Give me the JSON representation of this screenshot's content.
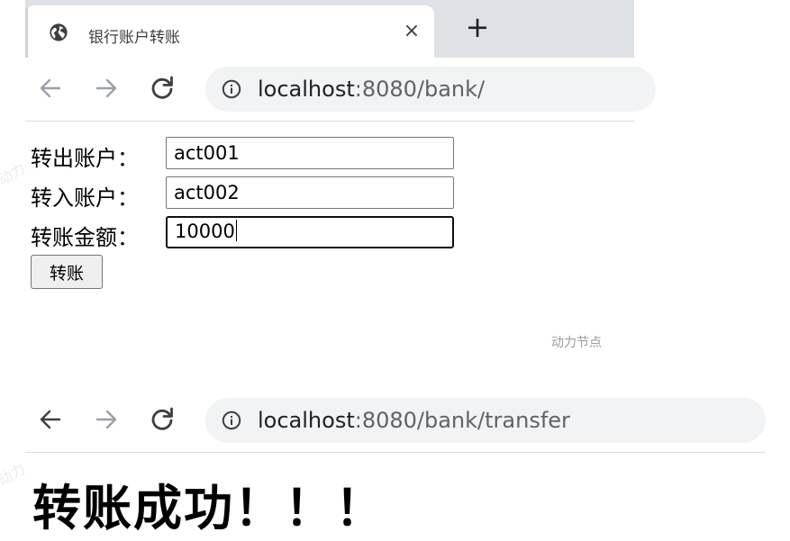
{
  "window1": {
    "tab": {
      "favicon": "globe-icon",
      "title": "银行账户转账",
      "close_glyph": "×"
    },
    "new_tab_glyph": "+",
    "address": {
      "host": "localhost",
      "path": ":8080/bank/"
    }
  },
  "form": {
    "fields": [
      {
        "label": "转出账户：",
        "value": "act001"
      },
      {
        "label": "转入账户：",
        "value": "act002"
      },
      {
        "label": "转账金额：",
        "value": "10000"
      }
    ],
    "submit_label": "转账"
  },
  "watermark": "动力节点",
  "window2": {
    "address": {
      "host": "localhost",
      "path": ":8080/bank/transfer"
    },
    "heading": "转账成功！！！"
  }
}
